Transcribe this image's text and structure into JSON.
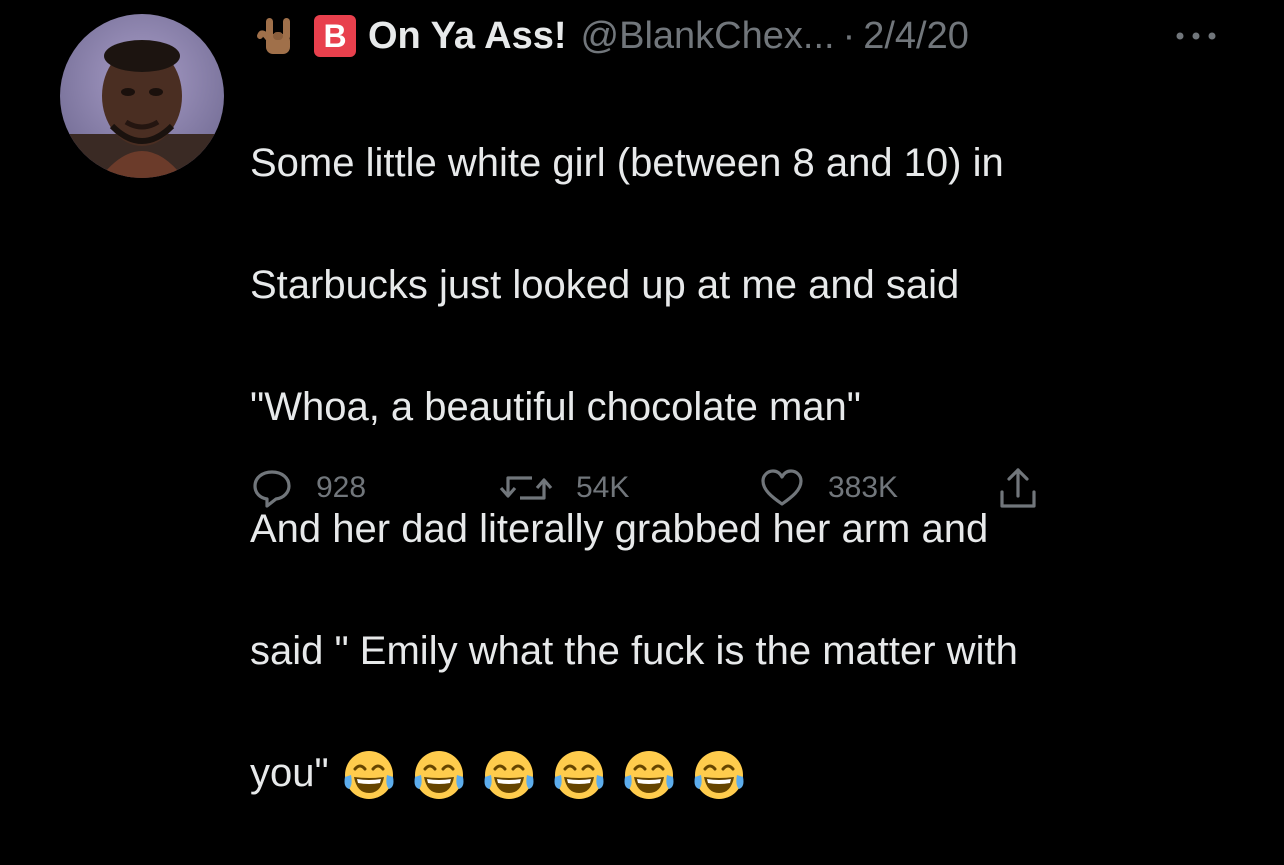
{
  "author": {
    "display_name": "On Ya Ass!",
    "handle": "@BlankChex...",
    "separator": "·",
    "date": "2/4/20",
    "badge_letter": "B",
    "emoji_prefix": "sign-of-the-horns-emoji"
  },
  "tweet": {
    "lines": [
      "Some little white girl (between 8 and 10) in",
      "Starbucks just looked up at me and said",
      "\"Whoa, a beautiful chocolate man\"",
      "And her dad literally grabbed her arm and",
      "said \" Emily what the fuck is the matter with",
      "you\""
    ],
    "trailing_emoji": "face-with-tears-of-joy",
    "trailing_emoji_count": 6
  },
  "actions": {
    "reply_count": "928",
    "retweet_count": "54K",
    "like_count": "383K"
  },
  "colors": {
    "background": "#000000",
    "text": "#e7e9ea",
    "secondary": "#71767b",
    "badge": "#e8404d"
  },
  "icons": {
    "reply": "speech-bubble-icon",
    "retweet": "retweet-icon",
    "like": "heart-icon",
    "share": "share-icon",
    "more": "more-dots-icon"
  }
}
